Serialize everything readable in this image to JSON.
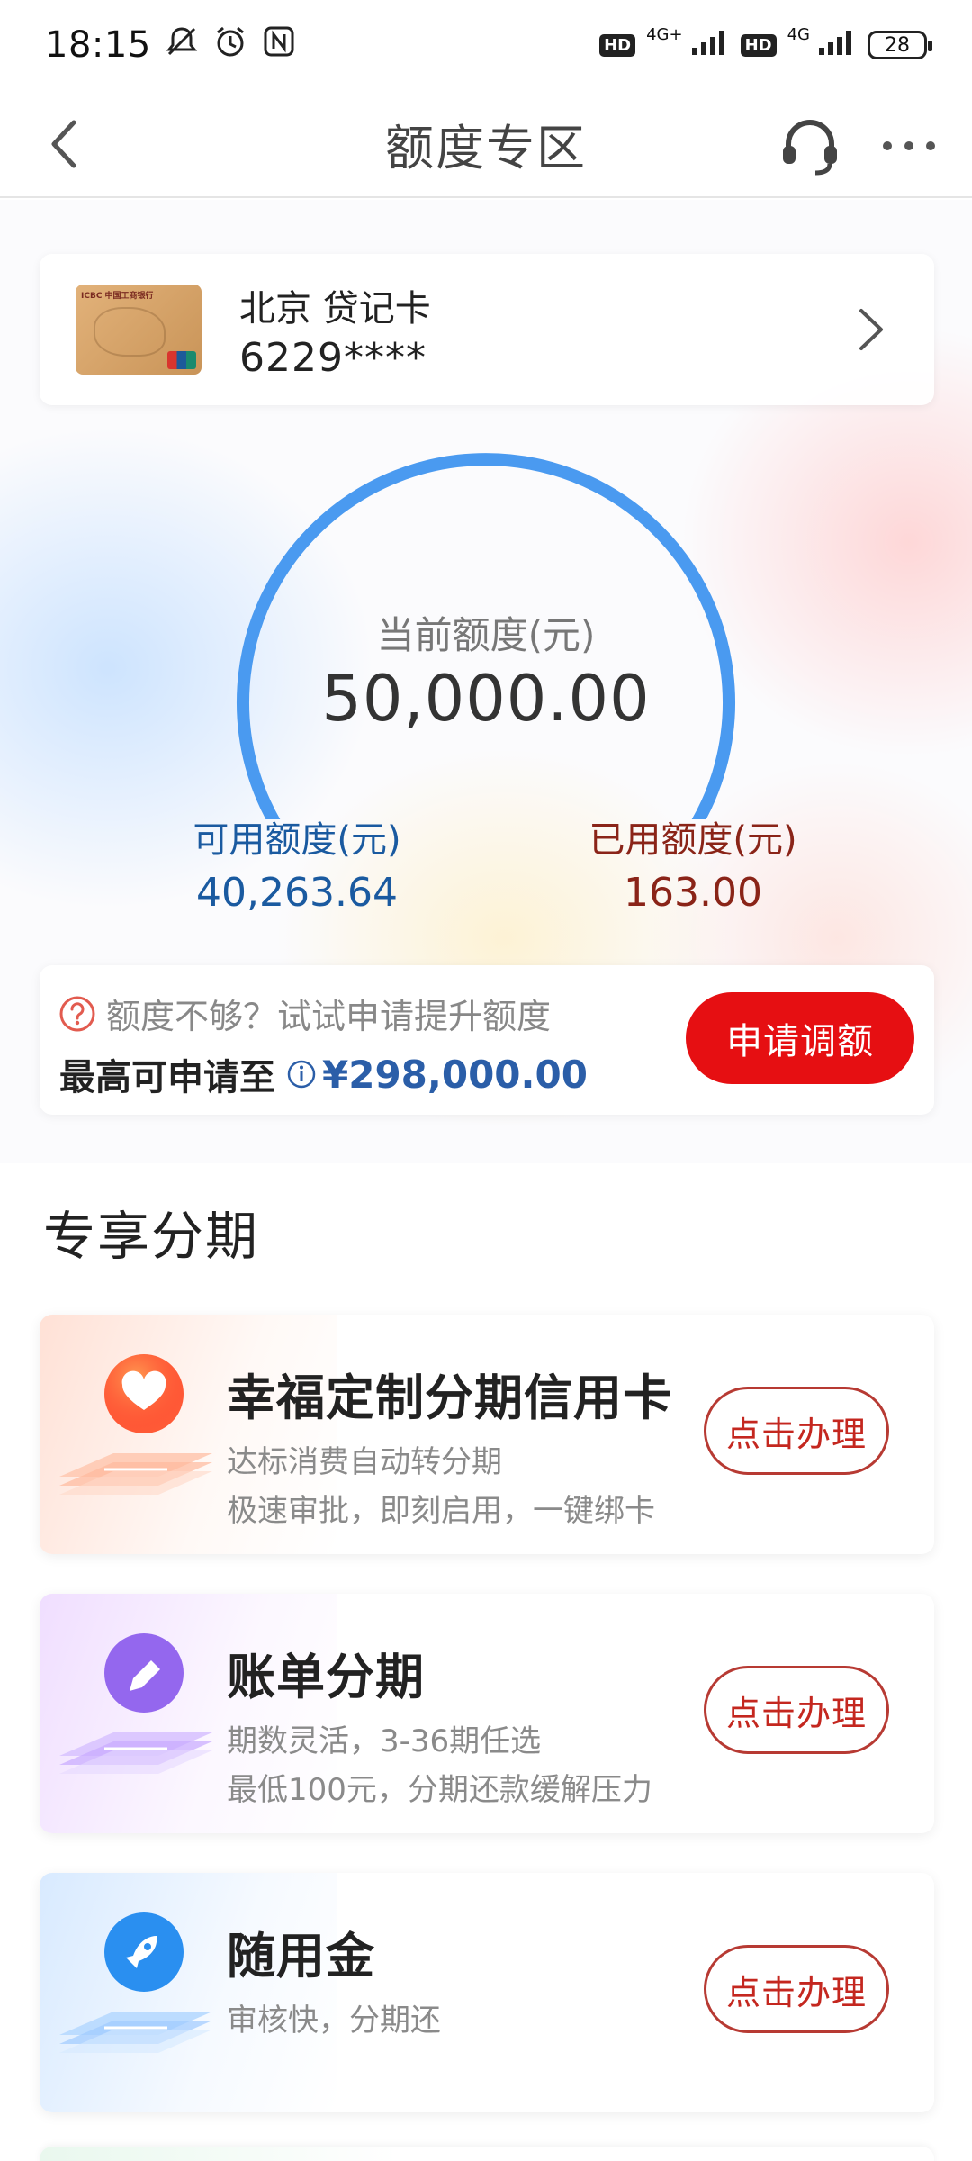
{
  "status_bar": {
    "time": "18:15",
    "network_1": "4G+",
    "network_2": "4G",
    "hd_label": "HD",
    "battery": "28"
  },
  "nav": {
    "title": "额度专区"
  },
  "card": {
    "name": "北京 贷记卡",
    "number": "6229****",
    "bank_logo_text": "ICBC 中国工商银行"
  },
  "gauge": {
    "label": "当前额度(元)",
    "value": "50,000.00",
    "available_label": "可用额度(元)",
    "available_value": "40,263.64",
    "used_label": "已用额度(元)",
    "used_value": "163.00",
    "used_fraction": 0.00326,
    "arc_color": "#4a9af0",
    "used_color": "#e8583c"
  },
  "promo": {
    "question": "额度不够？试试申请提升额度",
    "max_label": "最高可申请至",
    "max_amount": "¥298,000.00",
    "apply_button": "申请调额"
  },
  "section": {
    "title": "专享分期"
  },
  "products": [
    {
      "title": "幸福定制分期信用卡",
      "desc1": "达标消费自动转分期",
      "desc2": "极速审批，即刻启用，一键绑卡",
      "button": "点击办理",
      "icon": "heart-icon",
      "theme": "#ff6a3d"
    },
    {
      "title": "账单分期",
      "desc1": "期数灵活，3-36期任选",
      "desc2": "最低100元，分期还款缓解压力",
      "button": "点击办理",
      "icon": "pencil-icon",
      "theme": "#9b6cf0"
    },
    {
      "title": "随用金",
      "desc1": "审核快，分期还",
      "desc2": "",
      "button": "点击办理",
      "icon": "rocket-icon",
      "theme": "#2f8ff0"
    }
  ],
  "colors": {
    "accent_red": "#e60f12",
    "available_blue": "#1a5aa0",
    "used_brown": "#8a2418",
    "amount_blue": "#2b5ea8"
  }
}
